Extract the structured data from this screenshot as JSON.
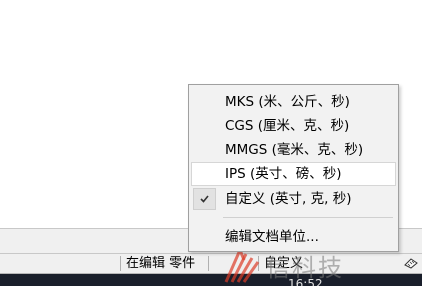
{
  "menu": {
    "items": [
      {
        "label": "MKS (米、公斤、秒)",
        "checked": false
      },
      {
        "label": "CGS (厘米、克、秒)",
        "checked": false
      },
      {
        "label": "MMGS (毫米、克、秒)",
        "checked": false
      },
      {
        "label": "IPS (英寸、磅、秒)",
        "checked": false,
        "highlighted": true
      },
      {
        "label": "自定义 (英寸, 克, 秒)",
        "checked": true
      }
    ],
    "edit_label": "编辑文档单位..."
  },
  "status_bar": {
    "editing_label": "在编辑 零件",
    "units_label": "自定义"
  },
  "taskbar": {
    "clock": "16:52"
  },
  "watermark": {
    "text": "信科技"
  }
}
